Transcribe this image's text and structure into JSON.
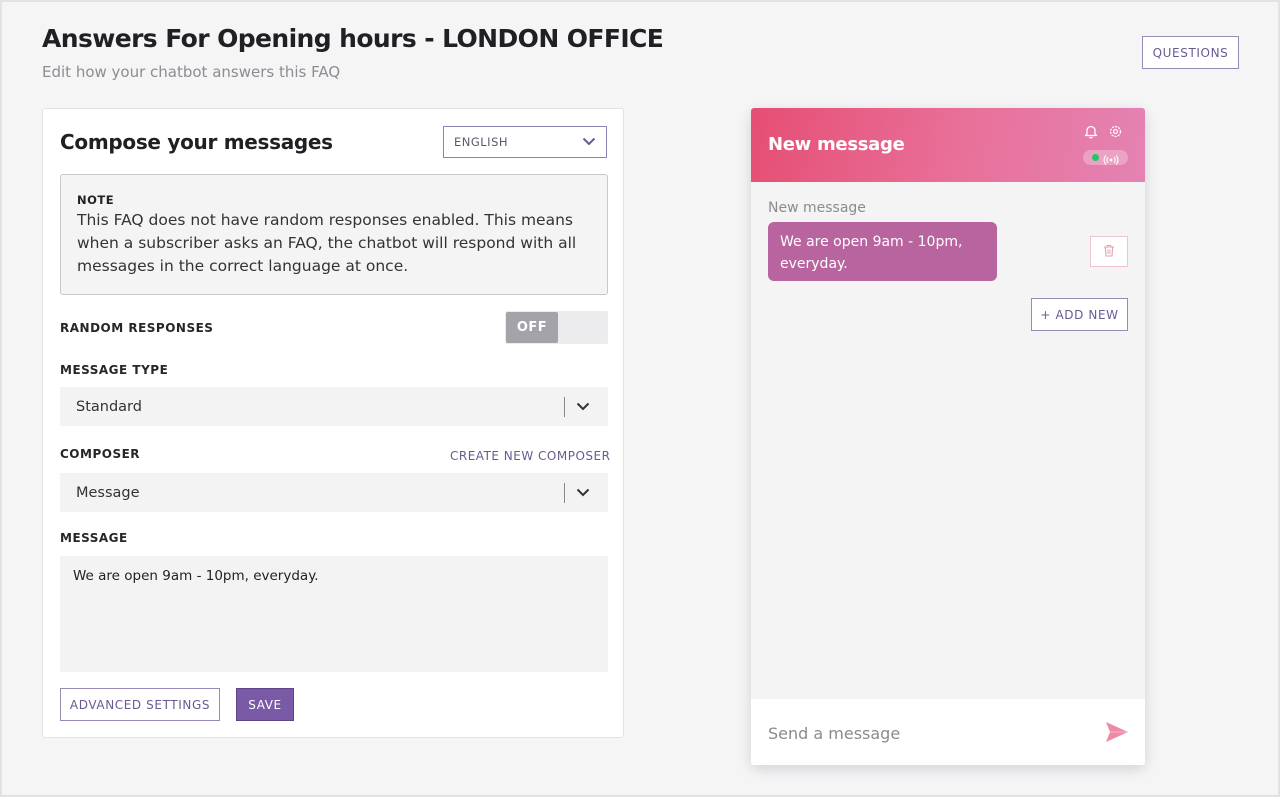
{
  "header": {
    "title": "Answers For Opening hours - LONDON OFFICE",
    "subtitle": "Edit how your chatbot answers this FAQ",
    "questions_label": "QUESTIONS"
  },
  "compose": {
    "title": "Compose your messages",
    "language": "ENGLISH",
    "note_label": "NOTE",
    "note_text": "This FAQ does not have random responses enabled. This means when a subscriber asks an FAQ, the chatbot will respond with all messages in the correct language at once.",
    "random_label": "RANDOM RESPONSES",
    "random_state": "OFF",
    "type_label": "MESSAGE TYPE",
    "type_value": "Standard",
    "composer_label": "COMPOSER",
    "create_composer": "CREATE NEW COMPOSER",
    "composer_value": "Message",
    "message_label": "MESSAGE",
    "message_value": "We are open 9am - 10pm, everyday.",
    "advanced_label": "ADVANCED SETTINGS",
    "save_label": "SAVE"
  },
  "chat": {
    "title": "New message",
    "label": "New message",
    "bubble_text": "We are open 9am - 10pm, everyday.",
    "add_new_label": "+ ADD NEW",
    "input_placeholder": "Send a message"
  },
  "icons": {
    "bell": "bell-icon",
    "settings": "gear-icon",
    "status": "broadcast-icon",
    "trash": "trash-icon",
    "send": "send-icon",
    "chevron": "chevron-down-icon"
  },
  "colors": {
    "accent": "#7a5aa6",
    "header_start": "#e64e74",
    "header_end": "#e483b3",
    "bubble": "#b8649f",
    "status_online": "#27c46b"
  }
}
